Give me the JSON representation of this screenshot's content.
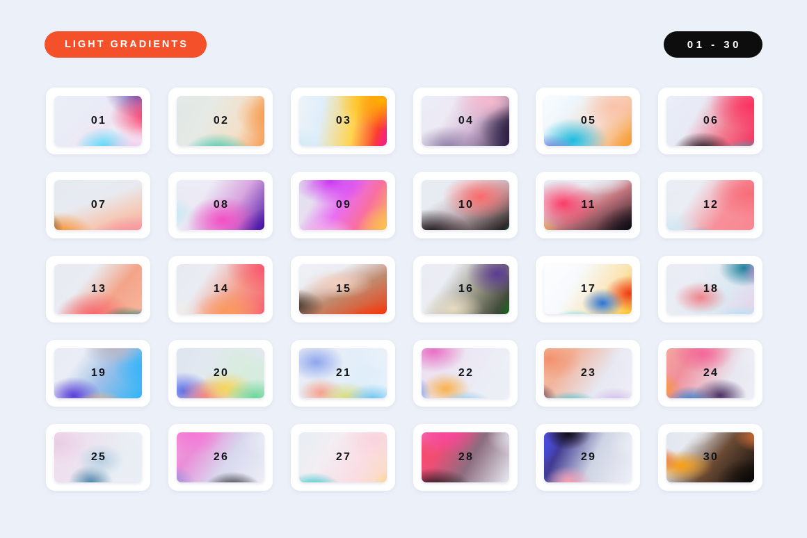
{
  "header": {
    "title_badge": "LIGHT GRADIENTS",
    "range_badge": "01 - 30",
    "title_badge_color": "#f4502a",
    "range_badge_color": "#0d0d0d"
  },
  "page": {
    "background_color": "#ecf0f8",
    "card_color": "#ffffff",
    "number_color": "#111418"
  },
  "grid": {
    "columns": 6,
    "rows": 5,
    "count": 30
  },
  "swatches": [
    {
      "label": "01",
      "base": "linear-gradient(135deg,#eceef7 0%,#e9ebf6 38%,#efe6f3 60%,#ffffff 100%)",
      "blobs": [
        "radial-gradient(42% 52% at 86% 10%, #5b3fa8 0%, rgba(91,63,168,0) 72%)",
        "radial-gradient(46% 52% at 92% 44%, #f8295f 0%, rgba(248,41,95,0) 70%)",
        "radial-gradient(34% 40% at 56% 88%, #4fd7fb 0%, rgba(79,215,251,0) 72%)",
        "radial-gradient(40% 44% at 82% 92%, #f0c4ec 0%, rgba(240,196,236,0) 74%)"
      ]
    },
    {
      "label": "02",
      "base": "linear-gradient(115deg,#dfe6e4 0%,#e6eae6 34%,#f3e0c8 70%,#f79c52 100%)",
      "blobs": [
        "radial-gradient(48% 54% at 96% 40%, #f7943f 0%, rgba(247,148,63,0) 70%)",
        "radial-gradient(40% 46% at 48% 100%, #0fc2a3 0%, rgba(15,194,163,0) 72%)",
        "radial-gradient(38% 40% at 8% 8%, #e7ecea 0%, rgba(231,236,234,0) 76%)"
      ]
    },
    {
      "label": "03",
      "base": "linear-gradient(100deg,#eef3f8 0%,#dfeefa 26%,#ffd34d 62%,#fb3f2b 88%,#f6218c 100%)",
      "blobs": [
        "radial-gradient(52% 60% at 82% 20%, #ffb300 0%, rgba(255,179,0,0) 70%)",
        "radial-gradient(44% 56% at 100% 92%, #f3168f 0%, rgba(243,22,143,0) 70%)",
        "radial-gradient(40% 48% at 6% 92%, #c9e6f6 0%, rgba(201,230,246,0) 76%)"
      ]
    },
    {
      "label": "04",
      "base": "linear-gradient(120deg,#e9ebf5 0%,#eeeaf4 30%,#d6b9d6 58%,#2b1c45 100%)",
      "blobs": [
        "radial-gradient(44% 44% at 70% 22%, #f7b9cd 0%, rgba(247,185,205,0) 70%)",
        "radial-gradient(48% 52% at 96% 62%, #211536 0%, rgba(33,21,54,0) 72%)",
        "radial-gradient(40% 42% at 36% 88%, #8f7fa8 0%, rgba(143,127,168,0) 74%)",
        "radial-gradient(34% 38% at 8% 12%, #eef0f8 0%, rgba(238,240,248,0) 78%)"
      ]
    },
    {
      "label": "05",
      "base": "linear-gradient(125deg,#fafcff 0%,#eef6fb 28%,#f7d9cb 62%,#f8a03a 100%)",
      "blobs": [
        "radial-gradient(40% 46% at 38% 78%, #19bde2 0%, rgba(25,189,226,0) 70%)",
        "radial-gradient(36% 40% at 18% 98%, #5a63d8 0%, rgba(90,99,216,0) 72%)",
        "radial-gradient(40% 44% at 96% 86%, #f79a2b 0%, rgba(247,154,43,0) 70%)",
        "radial-gradient(34% 38% at 72% 30%, #f9c2a8 0%, rgba(249,194,168,0) 76%)"
      ]
    },
    {
      "label": "06",
      "base": "linear-gradient(120deg,#e9ecf6 0%,#e8ebf5 34%,#f2798e 68%,#f62f5e 100%)",
      "blobs": [
        "radial-gradient(50% 52% at 84% 28%, #fa3360 0%, rgba(250,51,96,0) 70%)",
        "radial-gradient(34% 36% at 44% 92%, #15121a 0%, rgba(21,18,26,0) 72%)",
        "radial-gradient(38% 34% at 82% 100%, #0fc6cd 0%, rgba(15,198,205,0) 72%)",
        "radial-gradient(30% 34% at 10% 14%, #eceff8 0%, rgba(236,239,248,0) 78%)"
      ]
    },
    {
      "label": "07",
      "base": "linear-gradient(160deg,#e5e9f0 0%,#e7ebf1 42%,#f6c6b2 76%,#f8a0a8 100%)",
      "blobs": [
        "radial-gradient(40% 46% at 18% 92%, #f98a1c 0%, rgba(249,138,28,0) 70%)",
        "radial-gradient(26% 32% at 2% 82%, #3d2a22 0%, rgba(61,42,34,0) 74%)",
        "radial-gradient(44% 42% at 76% 96%, #f79098 0%, rgba(247,144,152,0) 72%)",
        "radial-gradient(42% 40% at 46% 10%, #e8ecf2 0%, rgba(232,236,242,0) 78%)"
      ]
    },
    {
      "label": "08",
      "base": "linear-gradient(125deg,#e9eaf4 0%,#eceaf5 30%,#d9a6e0 62%,#4d17a8 100%)",
      "blobs": [
        "radial-gradient(44% 50% at 52% 72%, #f44fc4 0%, rgba(244,79,196,0) 68%)",
        "radial-gradient(46% 50% at 96% 88%, #3d0f9e 0%, rgba(61,15,158,0) 70%)",
        "radial-gradient(30% 32% at 8% 62%, #bfe8f2 0%, rgba(191,232,242,0) 74%)",
        "radial-gradient(34% 34% at 26% 10%, #ecedf7 0%, rgba(236,237,247,0) 78%)"
      ]
    },
    {
      "label": "09",
      "base": "linear-gradient(120deg,#e2e0ee 0%,#e6dff0 22%,#e86df2 48%,#f96fa0 72%,#fbbf4e 100%)",
      "blobs": [
        "radial-gradient(44% 48% at 40% 16%, #cf35f2 0%, rgba(207,53,242,0) 70%)",
        "radial-gradient(44% 48% at 92% 82%, #fcc24d 0%, rgba(252,194,77,0) 70%)",
        "radial-gradient(34% 40% at 36% 96%, #f6c7e6 0%, rgba(246,199,230,0) 74%)",
        "radial-gradient(30% 34% at 4% 10%, #dfdcec 0%, rgba(223,220,236,0) 78%)"
      ]
    },
    {
      "label": "10",
      "base": "linear-gradient(150deg,#e6eaf1 0%,#e8ecf2 30%,#b9a6ac 58%,#14100f 100%)",
      "blobs": [
        "radial-gradient(44% 48% at 62% 38%, #fb6a6a 0%, rgba(251,106,106,0) 70%)",
        "radial-gradient(46% 50% at 22% 92%, #09060a 0%, rgba(9,6,10,0) 72%)",
        "radial-gradient(30% 34% at 100% 92%, #17e2b6 0%, rgba(23,226,182,0) 70%)",
        "radial-gradient(32% 36% at 10% 10%, #e9edf3 0%, rgba(233,237,243,0) 78%)"
      ]
    },
    {
      "label": "11",
      "base": "linear-gradient(150deg,#e6eaf1 0%,#e9edf3 28%,#c5767f 56%,#17121a 100%)",
      "blobs": [
        "radial-gradient(42% 48% at 30% 48%, #fb3b66 0%, rgba(251,59,102,0) 70%)",
        "radial-gradient(34% 38% at 4% 92%, #fbb01e 0%, rgba(251,176,30,0) 72%)",
        "radial-gradient(50% 52% at 92% 86%, #0d0a12 0%, rgba(13,10,18,0) 72%)",
        "radial-gradient(34% 36% at 62% 8%, #e9edf3 0%, rgba(233,237,243,0) 78%)"
      ]
    },
    {
      "label": "12",
      "base": "linear-gradient(125deg,#e9ecf4 0%,#eaedf4 30%,#f7909a 66%,#f8868f 100%)",
      "blobs": [
        "radial-gradient(46% 50% at 82% 34%, #f76d7a 0%, rgba(247,109,122,0) 70%)",
        "radial-gradient(30% 34% at 40% 104%, #17c8f3 0%, rgba(23,200,243,0) 68%)",
        "radial-gradient(34% 38% at 18% 86%, #cfe8f4 0%, rgba(207,232,244,0) 74%)",
        "radial-gradient(32% 34% at 8% 10%, #eceff6 0%, rgba(236,239,246,0) 78%)"
      ]
    },
    {
      "label": "13",
      "base": "linear-gradient(130deg,#e7eaf1 0%,#e9ecf2 34%,#f3a489 66%,#f7b69c 100%)",
      "blobs": [
        "radial-gradient(44% 50% at 46% 88%, #f7636c 0%, rgba(247,99,108,0) 70%)",
        "radial-gradient(32% 34% at 90% 100%, #1a62b8 0%, rgba(26,98,184,0) 70%)",
        "radial-gradient(28% 30% at 72% 96%, #1d7a5e 0%, rgba(29,122,94,0) 72%)",
        "radial-gradient(40% 42% at 12% 14%, #e8ecf3 0%, rgba(232,236,243,0) 78%)"
      ]
    },
    {
      "label": "14",
      "base": "linear-gradient(125deg,#e8eaf2 0%,#eaecf3 30%,#f59a86 66%,#f75f72 100%)",
      "blobs": [
        "radial-gradient(48% 52% at 88% 20%, #f9536f 0%, rgba(249,83,111,0) 70%)",
        "radial-gradient(40% 42% at 56% 82%, #fa9a5c 0%, rgba(250,154,92,0) 72%)",
        "radial-gradient(36% 38% at 10% 88%, #f0eee9 0%, rgba(240,238,233,0) 76%)",
        "radial-gradient(32% 34% at 8% 10%, #e9ebf3 0%, rgba(233,235,243,0) 78%)"
      ]
    },
    {
      "label": "15",
      "base": "linear-gradient(155deg,#edeff5 0%,#eceef4 26%,#c08a6e 56%,#f03d10 100%)",
      "blobs": [
        "radial-gradient(50% 40% at 82% 96%, #f53b0b 0%, rgba(245,59,11,0) 66%)",
        "radial-gradient(34% 34% at 10% 74%, #3b2a22 0%, rgba(59,42,34,0) 72%)",
        "radial-gradient(40% 30% at 46% 42%, #f4cfc0 0%, rgba(244,207,192,0) 72%)",
        "radial-gradient(34% 36% at 16% 10%, #eef0f6 0%, rgba(238,240,246,0) 78%)"
      ]
    },
    {
      "label": "16",
      "base": "linear-gradient(125deg,#e9ecf2 0%,#eaedf3 28%,#9f9c8c 58%,#1c2a18 100%)",
      "blobs": [
        "radial-gradient(36% 44% at 76% 28%, #5d3b94 0%, rgba(93,59,148,0) 70%)",
        "radial-gradient(26% 36% at 100% 24%, #e8e839 0%, rgba(232,232,57,0) 66%)",
        "radial-gradient(30% 42% at 96% 84%, #14a226 0%, rgba(20,162,38,0) 68%)",
        "radial-gradient(34% 34% at 40% 78%, #e7dcc2 0%, rgba(231,220,194,0) 74%)",
        "radial-gradient(30% 32% at 10% 12%, #ebeef4 0%, rgba(235,238,244,0) 78%)"
      ]
    },
    {
      "label": "17",
      "base": "linear-gradient(120deg,#fcfdff 0%,#f7fafd 34%,#fbe3ae 74%,#fcc028 100%)",
      "blobs": [
        "radial-gradient(30% 38% at 84% 56%, #ee3a14 0%, rgba(238,58,20,0) 68%)",
        "radial-gradient(24% 30% at 62% 70%, #2b74d4 0%, rgba(43,116,212,0) 70%)",
        "radial-gradient(30% 30% at 40% 100%, #2fd4e8 0%, rgba(47,212,232,0) 70%)",
        "radial-gradient(34% 36% at 14% 16%, #fcfdff 0%, rgba(252,253,255,0) 78%)"
      ]
    },
    {
      "label": "18",
      "base": "linear-gradient(125deg,#e9ecf4 0%,#ebedf5 30%,#dbe9f2 64%,#e8d3ea 100%)",
      "blobs": [
        "radial-gradient(30% 38% at 78% 20%, #1a7f9b 0%, rgba(26,127,155,0) 70%)",
        "radial-gradient(28% 30% at 96% 26%, #d67fcb 0%, rgba(214,127,203,0) 72%)",
        "radial-gradient(30% 32% at 42% 62%, #f0838c 0%, rgba(240,131,140,0) 72%)",
        "radial-gradient(38% 36% at 78% 98%, #9fe8f8 0%, rgba(159,232,248,0) 72%)",
        "radial-gradient(32% 34% at 8% 12%, #ebeef5 0%, rgba(235,238,245,0) 78%)"
      ]
    },
    {
      "label": "19",
      "base": "linear-gradient(125deg,#e9ecf4 0%,#eaedf5 26%,#9fbfe8 56%,#2fb4f8 100%)",
      "blobs": [
        "radial-gradient(44% 50% at 92% 42%, #2fb4fa 0%, rgba(47,180,250,0) 68%)",
        "radial-gradient(32% 38% at 30% 82%, #5b3fd8 0%, rgba(91,63,216,0) 70%)",
        "radial-gradient(28% 30% at 52% 96%, #f8b26a 0%, rgba(248,178,106,0) 72%)",
        "radial-gradient(32% 34% at 62% 14%, #b9b6c4 0%, rgba(185,182,196,0) 76%)",
        "radial-gradient(30% 32% at 6% 10%, #eaedf5 0%, rgba(234,237,245,0) 78%)"
      ]
    },
    {
      "label": "20",
      "base": "linear-gradient(115deg,#dfe5ef 0%,#e2e8f0 30%,#d8ecdd 70%,#d4ece2 100%)",
      "blobs": [
        "radial-gradient(32% 40% at 20% 76%, #5b6ee8 0%, rgba(91,110,232,0) 70%)",
        "radial-gradient(30% 34% at 38% 82%, #f27a86 0%, rgba(242,122,134,0) 72%)",
        "radial-gradient(32% 34% at 54% 72%, #f7d457 0%, rgba(247,212,87,0) 72%)",
        "radial-gradient(34% 36% at 78% 84%, #6fd79a 0%, rgba(111,215,154,0) 72%)",
        "radial-gradient(34% 36% at 86% 16%, #e2e8f1 0%, rgba(226,232,241,0) 78%)"
      ]
    },
    {
      "label": "21",
      "base": "linear-gradient(120deg,#eaedf6 0%,#e8eef6 32%,#dfeefa 70%,#e7f1fb 100%)",
      "blobs": [
        "radial-gradient(32% 38% at 28% 34%, #8ea6ee 0%, rgba(142,166,238,0) 72%)",
        "radial-gradient(26% 30% at 32% 78%, #f6a08c 0%, rgba(246,160,140,0) 72%)",
        "radial-gradient(28% 30% at 52% 84%, #d9dd7e 0%, rgba(217,221,126,0) 74%)",
        "radial-gradient(30% 32% at 74% 88%, #6cc2f0 0%, rgba(108,194,240,0) 72%)",
        "radial-gradient(32% 34% at 86% 24%, #ecf1f8 0%, rgba(236,241,248,0) 78%)"
      ]
    },
    {
      "label": "22",
      "base": "linear-gradient(120deg,#ecdff0 0%,#ece3f2 30%,#ebedf5 70%,#edeff6 100%)",
      "blobs": [
        "radial-gradient(38% 44% at 24% 18%, #e86fc4 0%, rgba(232,111,196,0) 70%)",
        "radial-gradient(30% 40% at 2% 78%, #2f6fe8 0%, rgba(47,111,232,0) 68%)",
        "radial-gradient(28% 32% at 34% 72%, #f9b14c 0%, rgba(249,177,76,0) 72%)",
        "radial-gradient(30% 30% at 50% 96%, #7fc5ef 0%, rgba(127,197,239,0) 72%)",
        "radial-gradient(34% 36% at 92% 30%, #eef0f7 0%, rgba(238,240,247,0) 78%)"
      ]
    },
    {
      "label": "23",
      "base": "linear-gradient(125deg,#f4c6a0 0%,#f2b39b 26%,#e6e8f2 66%,#f0eef7 100%)",
      "blobs": [
        "radial-gradient(38% 44% at 18% 30%, #f2906f 0%, rgba(242,144,111,0) 70%)",
        "radial-gradient(32% 34% at 2% 86%, #15122a 0%, rgba(21,18,42,0) 72%)",
        "radial-gradient(34% 32% at 36% 98%, #10b6bd 0%, rgba(16,182,189,0) 70%)",
        "radial-gradient(28% 30% at 72% 92%, #cfb6ea 0%, rgba(207,182,234,0) 74%)",
        "radial-gradient(34% 36% at 92% 20%, #eceef6 0%, rgba(236,238,246,0) 78%)"
      ]
    },
    {
      "label": "24",
      "base": "linear-gradient(120deg,#f4a6a0 0%,#f08f9c 24%,#e8e7f1 70%,#edeef6 100%)",
      "blobs": [
        "radial-gradient(34% 40% at 44% 22%, #f4679a 0%, rgba(244,103,154,0) 70%)",
        "radial-gradient(30% 36% at 6% 72%, #fa9a24 0%, rgba(250,154,36,0) 70%)",
        "radial-gradient(30% 34% at 34% 92%, #1a73c9 0%, rgba(26,115,201,0) 70%)",
        "radial-gradient(30% 34% at 58% 82%, #4b2f62 0%, rgba(75,47,98,0) 72%)",
        "radial-gradient(34% 36% at 92% 24%, #edeff6 0%, rgba(237,239,246,0) 78%)"
      ]
    },
    {
      "label": "25",
      "base": "linear-gradient(120deg,#f0dded 0%,#eee0ee 28%,#e8edf3 66%,#ebeef5 100%)",
      "blobs": [
        "radial-gradient(34% 40% at 16% 30%, #e9cde4 0%, rgba(233,205,228,0) 74%)",
        "radial-gradient(26% 36% at 44% 86%, #4e87a8 0%, rgba(78,135,168,0) 70%)",
        "radial-gradient(26% 32% at 52% 54%, #b6cfe2 0%, rgba(182,207,226,0) 74%)",
        "radial-gradient(34% 36% at 90% 20%, #eceff6 0%, rgba(236,239,246,0) 78%)"
      ]
    },
    {
      "label": "26",
      "base": "linear-gradient(125deg,#f29ddd 0%,#ea8fd8 24%,#d8d8ee 58%,#eceef6 100%)",
      "blobs": [
        "radial-gradient(38% 44% at 26% 16%, #f478d6 0%, rgba(244,120,214,0) 70%)",
        "radial-gradient(30% 34% at 8% 86%, #8f8fe0 0%, rgba(143,143,224,0) 72%)",
        "radial-gradient(34% 36% at 60% 96%, #120f14 0%, rgba(18,15,20,0) 70%)",
        "radial-gradient(34% 36% at 94% 24%, #eceef6 0%, rgba(236,238,246,0) 78%)"
      ]
    },
    {
      "label": "27",
      "base": "linear-gradient(120deg,#e7edf3 0%,#f2eef2 32%,#fadde4 68%,#fbdcc0 100%)",
      "blobs": [
        "radial-gradient(34% 38% at 76% 24%, #f9d4de 0%, rgba(249,212,222,0) 74%)",
        "radial-gradient(32% 36% at 96% 90%, #fbcf72 0%, rgba(251,207,114,0) 70%)",
        "radial-gradient(34% 36% at 26% 96%, #11bfc4 0%, rgba(17,191,196,0) 68%)",
        "radial-gradient(34% 36% at 8% 14%, #e9eef4 0%, rgba(233,238,244,0) 78%)"
      ]
    },
    {
      "label": "28",
      "base": "linear-gradient(120deg,#f56aa8 0%,#f04d76 24%,#8c6d80 56%,#e9ebf2 100%)",
      "blobs": [
        "radial-gradient(40% 44% at 34% 16%, #f8479f 0%, rgba(248,71,159,0) 68%)",
        "radial-gradient(32% 38% at 6% 46%, #f53f57 0%, rgba(245,63,87,0) 70%)",
        "radial-gradient(46% 44% at 24% 96%, #0d0a0c 0%, rgba(13,10,12,0) 70%)",
        "radial-gradient(34% 36% at 94% 20%, #ebedf4 0%, rgba(235,237,244,0) 78%)"
      ]
    },
    {
      "label": "29",
      "base": "linear-gradient(115deg,#5b52d8 0%,#413a92 20%,#cfd4e4 56%,#eef0f6 100%)",
      "blobs": [
        "radial-gradient(30% 40% at 8% 34%, #3f4ae8 0%, rgba(63,74,232,0) 68%)",
        "radial-gradient(22% 28% at 2% 84%, #14b4f2 0%, rgba(20,180,242,0) 70%)",
        "radial-gradient(26% 32% at 34% 16%, #120e18 0%, rgba(18,14,24,0) 72%)",
        "radial-gradient(26% 30% at 34% 84%, #f4a0b6 0%, rgba(244,160,182,0) 72%)",
        "radial-gradient(34% 36% at 94% 30%, #eef0f6 0%, rgba(238,240,246,0) 78%)"
      ]
    },
    {
      "label": "30",
      "base": "linear-gradient(130deg,#dfe5ef 0%,#e6e9f0 22%,#6a4a34 56%,#100d0c 100%)",
      "blobs": [
        "radial-gradient(40% 34% at 26% 62%, #fa9e10 0%, rgba(250,158,16,0) 66%)",
        "radial-gradient(30% 30% at 4% 54%, #e0521a 0%, rgba(224,82,26,0) 70%)",
        "radial-gradient(34% 34% at 92% 20%, #f07a36 0%, rgba(240,122,54,0) 68%)",
        "radial-gradient(44% 44% at 86% 82%, #0a0807 0%, rgba(10,8,7,0) 70%)",
        "radial-gradient(30% 32% at 34% 10%, #e7eaf1 0%, rgba(231,234,241,0) 78%)"
      ]
    }
  ]
}
